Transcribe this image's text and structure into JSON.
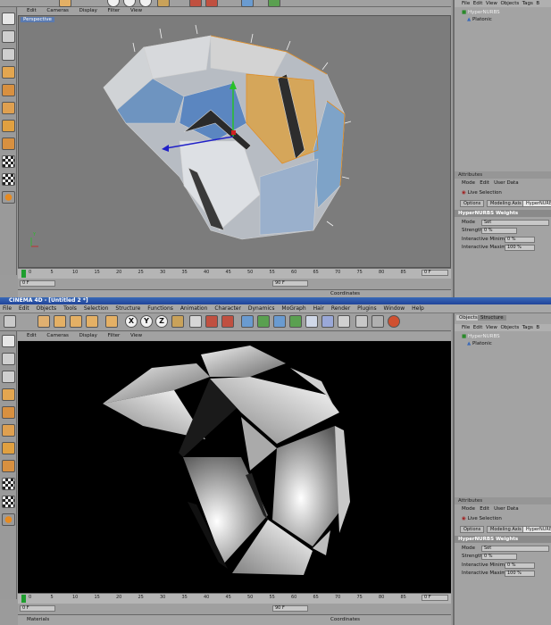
{
  "top": {
    "viewport_menu": [
      "Edit",
      "Cameras",
      "Display",
      "Filter",
      "View"
    ],
    "viewport_label": "Perspective",
    "timeline_ticks": [
      "0",
      "5",
      "10",
      "15",
      "20",
      "25",
      "30",
      "35",
      "40",
      "45",
      "50",
      "55",
      "60",
      "65",
      "70",
      "75",
      "80",
      "85",
      "90"
    ],
    "timeline_end": "0 F",
    "frame_start": "0 F",
    "frame_end": "90 F",
    "coordinates_label": "Coordinates",
    "axis_label": "Y"
  },
  "top_panel": {
    "menu": [
      "File",
      "Edit",
      "View",
      "Objects",
      "Tags",
      "B"
    ],
    "objects": [
      "HyperNURBS",
      "Platonic"
    ],
    "attributes_title": "Attributes",
    "attr_menu": [
      "Mode",
      "Edit",
      "User Data"
    ],
    "live_selection": "Live Selection",
    "subtabs": [
      "Options",
      "Modeling Axis",
      "HyperNURBS"
    ],
    "section": "HyperNURBS Weights",
    "rows": [
      {
        "label": "Mode",
        "value": "Set"
      },
      {
        "label": "Strength",
        "value": "0 %"
      },
      {
        "label": "Interactive Minimum",
        "value": "0 %"
      },
      {
        "label": "Interactive Maximum",
        "value": "100 %"
      }
    ]
  },
  "bottom": {
    "title": "CINEMA 4D - [Untitled 2 *]",
    "menu": [
      "File",
      "Edit",
      "Objects",
      "Tools",
      "Selection",
      "Structure",
      "Functions",
      "Animation",
      "Character",
      "Dynamics",
      "MoGraph",
      "Hair",
      "Render",
      "Plugins",
      "Window",
      "Help"
    ],
    "viewport_menu": [
      "Edit",
      "Cameras",
      "Display",
      "Filter",
      "View"
    ],
    "timeline_ticks": [
      "0",
      "5",
      "10",
      "15",
      "20",
      "25",
      "30",
      "35",
      "40",
      "45",
      "50",
      "55",
      "60",
      "65",
      "70",
      "75",
      "80",
      "85",
      "90"
    ],
    "timeline_end": "0 F",
    "frame_start": "0 F",
    "frame_end": "90 F",
    "materials_label": "Materials",
    "coordinates_label": "Coordinates",
    "toolbar_letters": [
      "X",
      "Y",
      "Z"
    ]
  },
  "bottom_panel": {
    "tabs": [
      "Objects",
      "Structure"
    ],
    "menu": [
      "File",
      "Edit",
      "View",
      "Objects",
      "Tags",
      "B"
    ],
    "objects": [
      "HyperNURBS",
      "Platonic"
    ],
    "attributes_title": "Attributes",
    "attr_menu": [
      "Mode",
      "Edit",
      "User Data"
    ],
    "live_selection": "Live Selection",
    "subtabs": [
      "Options",
      "Modeling Axis",
      "HyperNURBS"
    ],
    "section": "HyperNURBS Weights",
    "rows": [
      {
        "label": "Mode",
        "value": "Set"
      },
      {
        "label": "Strength",
        "value": "0 %"
      },
      {
        "label": "Interactive Minimum",
        "value": "0 %"
      },
      {
        "label": "Interactive Maximum",
        "value": "100 %"
      }
    ]
  },
  "colors": {
    "accent": "#e08a1e",
    "viewport_gray": "#7a7a7a",
    "titlebar": "#20449a",
    "render_bg": "#000000"
  }
}
